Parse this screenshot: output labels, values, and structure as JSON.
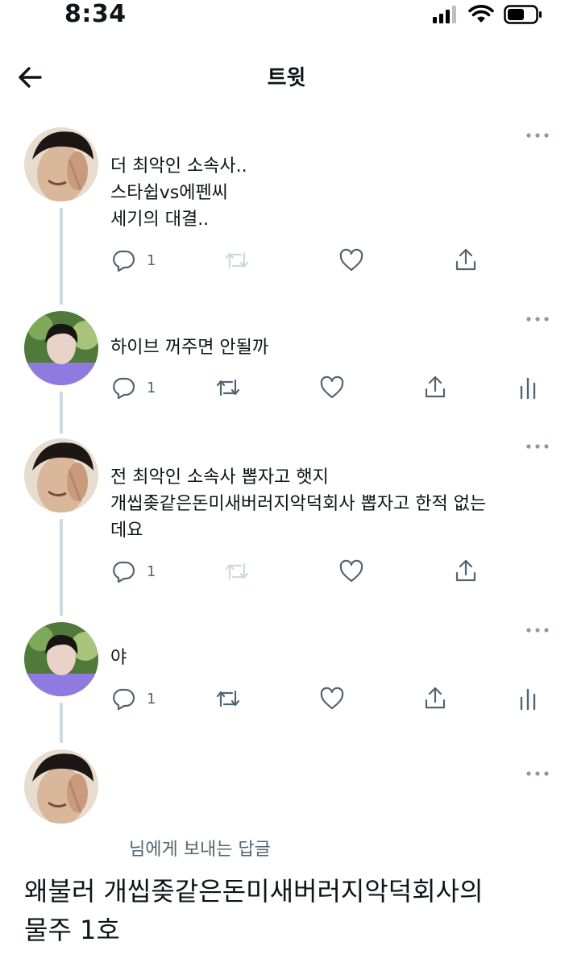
{
  "status_bar": {
    "time": "8:34"
  },
  "header": {
    "title": "트윗"
  },
  "tweets": [
    {
      "text": "더 최악인 소속사..\n스타쉽vs에펜씨\n세기의 대결..",
      "reply_count": "1"
    },
    {
      "text": "하이브 꺼주면 안될까",
      "reply_count": "1"
    },
    {
      "text": "전 최악인 소속사 뽑자고 햇지\n개씹좆같은돈미새버러지악덕회사 뽑자고 한적 없는\n데요",
      "reply_count": "1"
    },
    {
      "text": "야",
      "reply_count": "1"
    }
  ],
  "main_tweet": {
    "reply_to": "님에게 보내는 답글",
    "text": "왜불러 개씹좆같은돈미새버러지악덕회사의\n물주 1호"
  },
  "colors": {
    "accent": "#1d9bf0",
    "icon": "#536471",
    "thread_line": "#cfd9de"
  }
}
